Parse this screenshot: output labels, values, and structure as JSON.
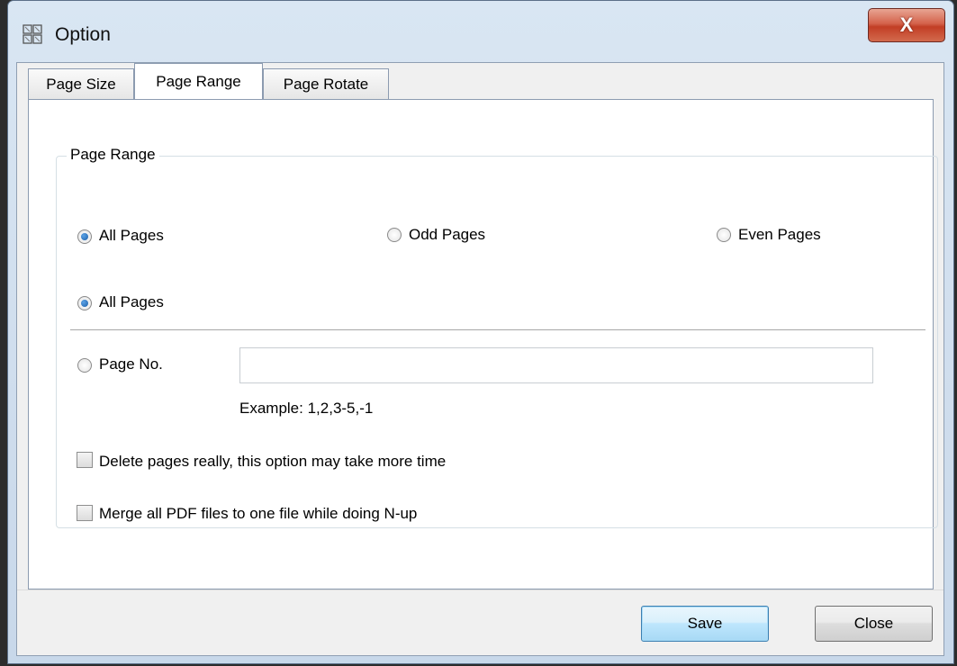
{
  "window": {
    "title": "Option",
    "icon": "app-grid-icon",
    "close_label": "X"
  },
  "tabs": [
    {
      "label": "Page Size",
      "active": false
    },
    {
      "label": "Page Range",
      "active": true
    },
    {
      "label": "Page Rotate",
      "active": false
    }
  ],
  "group": {
    "title": "Page Range",
    "page_filter": [
      {
        "label": "All Pages",
        "checked": true
      },
      {
        "label": "Odd Pages",
        "checked": false
      },
      {
        "label": "Even Pages",
        "checked": false
      }
    ],
    "scope": [
      {
        "label": "All Pages",
        "checked": true
      },
      {
        "label": "Page No.",
        "checked": false
      }
    ],
    "page_no_input": {
      "value": ""
    },
    "example": "Example: 1,2,3-5,-1",
    "options": [
      {
        "label": "Delete pages really, this option may take more time",
        "checked": false
      },
      {
        "label": "Merge all PDF files to one file while doing N-up",
        "checked": false
      }
    ]
  },
  "buttons": {
    "save": "Save",
    "close": "Close"
  },
  "colors": {
    "title_bar": "#d3e1f0",
    "close_button": "#c94a30",
    "radio_dot": "#1d5fa8",
    "default_button": "#bee6fd"
  }
}
